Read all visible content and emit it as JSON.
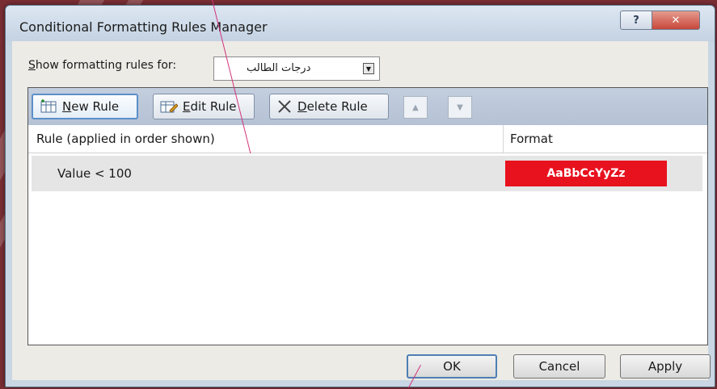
{
  "window": {
    "title": "Conditional Formatting Rules Manager",
    "help_label": "?",
    "close_label": "✕"
  },
  "show_rules": {
    "label_prefix": "S",
    "label_rest": "how formatting rules for:",
    "selected": "درجات الطالب"
  },
  "toolbar": {
    "new_rule_accel": "N",
    "new_rule_rest": "ew Rule",
    "edit_rule_accel": "E",
    "edit_rule_rest": "dit Rule",
    "delete_rule_accel": "D",
    "delete_rule_rest": "elete Rule",
    "move_up_icon": "triangle-up-icon",
    "move_down_icon": "triangle-down-icon"
  },
  "table": {
    "headers": {
      "rule": "Rule (applied in order shown)",
      "format": "Format"
    },
    "rows": [
      {
        "rule": "Value < 100",
        "format_preview": "AaBbCcYyZz",
        "format_color": "#e8121f"
      }
    ]
  },
  "footer": {
    "ok": "OK",
    "cancel": "Cancel",
    "apply": "Apply"
  }
}
